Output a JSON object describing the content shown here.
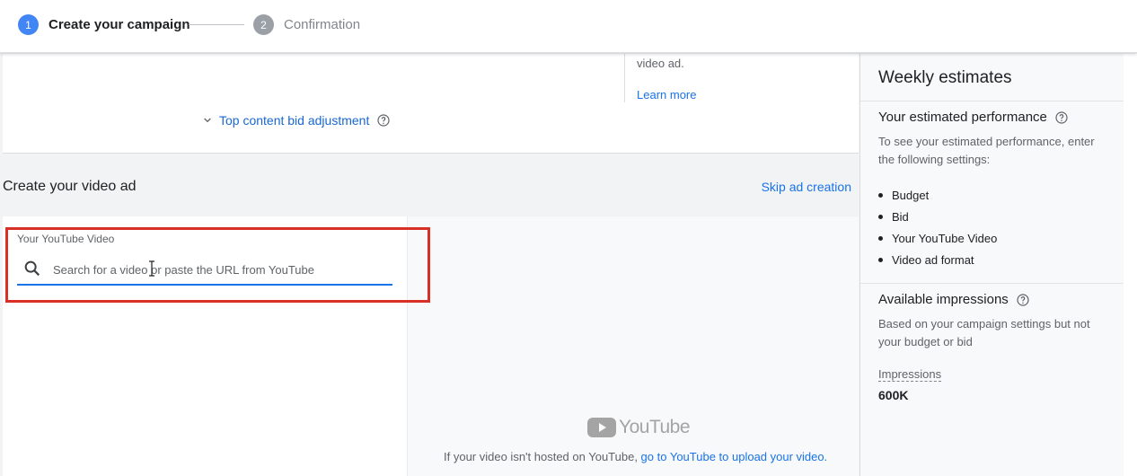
{
  "stepper": {
    "step1": {
      "number": "1",
      "label": "Create your campaign"
    },
    "step2": {
      "number": "2",
      "label": "Confirmation"
    }
  },
  "top_card": {
    "video_ad_text": "video ad.",
    "learn_more": "Learn more",
    "top_content_bid": "Top content bid adjustment"
  },
  "video_section": {
    "title": "Create your video ad",
    "skip_link": "Skip ad creation",
    "field_label": "Your YouTube Video",
    "search_placeholder": "Search for a video or paste the URL from YouTube",
    "youtube_wordmark": "YouTube",
    "hosted_note_prefix": "If your video isn't hosted on YouTube, ",
    "hosted_note_link": "go to YouTube to upload your video."
  },
  "estimates": {
    "title": "Weekly estimates",
    "performance_heading": "Your estimated performance",
    "performance_desc": "To see your estimated performance, enter the following settings:",
    "settings": [
      "Budget",
      "Bid",
      "Your YouTube Video",
      "Video ad format"
    ],
    "impressions_heading": "Available impressions",
    "impressions_desc": "Based on your campaign settings but not your budget or bid",
    "impressions_label": "Impressions",
    "impressions_value": "600K"
  },
  "colors": {
    "accent": "#1a73e8",
    "step_active": "#4285f4",
    "step_inactive": "#9aa0a6",
    "highlight": "#d93025"
  }
}
